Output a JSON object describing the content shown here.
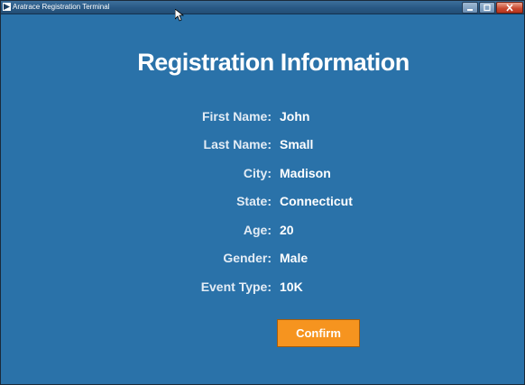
{
  "window": {
    "title": "Aratrace Registration Terminal"
  },
  "page": {
    "heading": "Registration Information"
  },
  "fields": [
    {
      "label": "First Name:",
      "value": "John"
    },
    {
      "label": "Last Name:",
      "value": "Small"
    },
    {
      "label": "City:",
      "value": "Madison"
    },
    {
      "label": "State:",
      "value": "Connecticut"
    },
    {
      "label": "Age:",
      "value": "20"
    },
    {
      "label": "Gender:",
      "value": "Male"
    },
    {
      "label": "Event Type:",
      "value": "10K"
    }
  ],
  "actions": {
    "confirm_label": "Confirm"
  },
  "colors": {
    "background": "#2a72a9",
    "confirm_button": "#f6941f",
    "text": "#ffffff"
  },
  "icons": {
    "app": "app-icon",
    "minimize": "minimize-icon",
    "maximize": "maximize-icon",
    "close": "close-icon",
    "cursor": "mouse-pointer-icon"
  }
}
